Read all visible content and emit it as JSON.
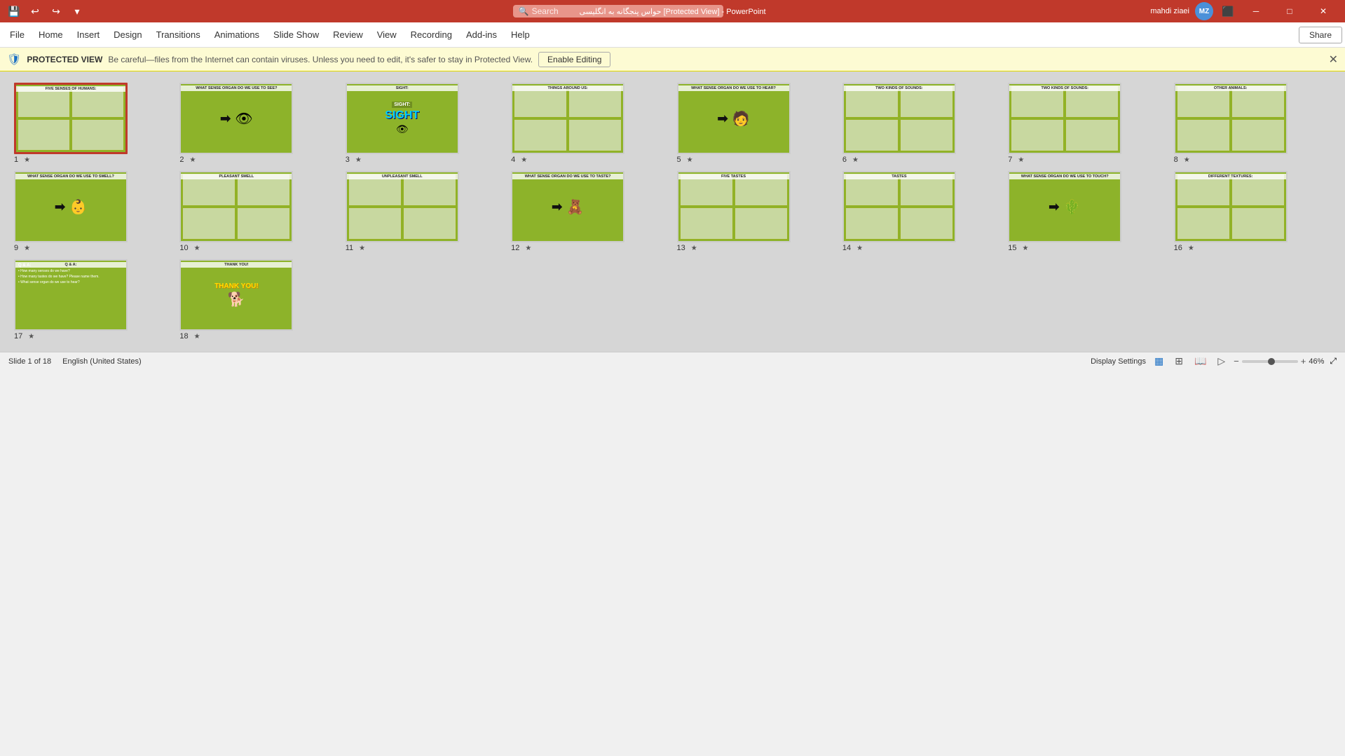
{
  "titlebar": {
    "title": "حواس پنجگانه به انگلیسی [Protected View] - PowerPoint",
    "user": "mahdi ziaei",
    "user_initials": "MZ",
    "minimize": "─",
    "maximize": "□",
    "close": "✕"
  },
  "searchbar": {
    "placeholder": "Search"
  },
  "menubar": {
    "items": [
      "File",
      "Home",
      "Insert",
      "Design",
      "Transitions",
      "Animations",
      "Slide Show",
      "Review",
      "View",
      "Recording",
      "Add-ins",
      "Help"
    ],
    "share_label": "Share"
  },
  "protectedbar": {
    "label": "PROTECTED VIEW",
    "message": "Be careful—files from the Internet can contain viruses. Unless you need to edit, it's safer to stay in Protected View.",
    "enable_editing": "Enable Editing"
  },
  "slides": [
    {
      "number": 1,
      "title": "FIVE SENSES OF HUMANS:",
      "type": "images",
      "selected": true
    },
    {
      "number": 2,
      "title": "WHAT SENSE ORGAN DO WE USE TO SEE?",
      "type": "arrow-eye"
    },
    {
      "number": 3,
      "title": "SIGHT:",
      "type": "sight-text"
    },
    {
      "number": 4,
      "title": "THINGS AROUND US:",
      "type": "images"
    },
    {
      "number": 5,
      "title": "WHAT SENSE ORGAN DO WE USE TO HEAR?",
      "type": "arrow-ear"
    },
    {
      "number": 6,
      "title": "TWO KINDS OF SOUNDS:",
      "type": "images"
    },
    {
      "number": 7,
      "title": "TWO KINDS OF SOUNDS:",
      "type": "images"
    },
    {
      "number": 8,
      "title": "OTHER ANIMALS:",
      "type": "images"
    },
    {
      "number": 9,
      "title": "WHAT SENSE ORGAN DO WE USE TO SMELL?",
      "type": "arrow-person"
    },
    {
      "number": 10,
      "title": "PLEASANT SMELL",
      "type": "images"
    },
    {
      "number": 11,
      "title": "UNPLEASANT SMELL",
      "type": "images"
    },
    {
      "number": 12,
      "title": "WHAT SENSE ORGAN DO WE USE TO TASTE?",
      "type": "arrow-winnie"
    },
    {
      "number": 13,
      "title": "FIVE TASTES",
      "type": "images"
    },
    {
      "number": 14,
      "title": "TASTES",
      "type": "images"
    },
    {
      "number": 15,
      "title": "WHAT SENSE ORGAN DO WE USE TO TOUCH?",
      "type": "arrow-cactus"
    },
    {
      "number": 16,
      "title": "DIFFERENT TEXTURES:",
      "type": "images"
    },
    {
      "number": 17,
      "title": "Q & A:",
      "type": "qa"
    },
    {
      "number": 18,
      "title": "THANK YOU!",
      "type": "thankyou"
    }
  ],
  "statusbar": {
    "slide_info": "Slide 1 of 18",
    "language": "English (United States)",
    "display_settings": "Display Settings",
    "zoom": "46%"
  }
}
